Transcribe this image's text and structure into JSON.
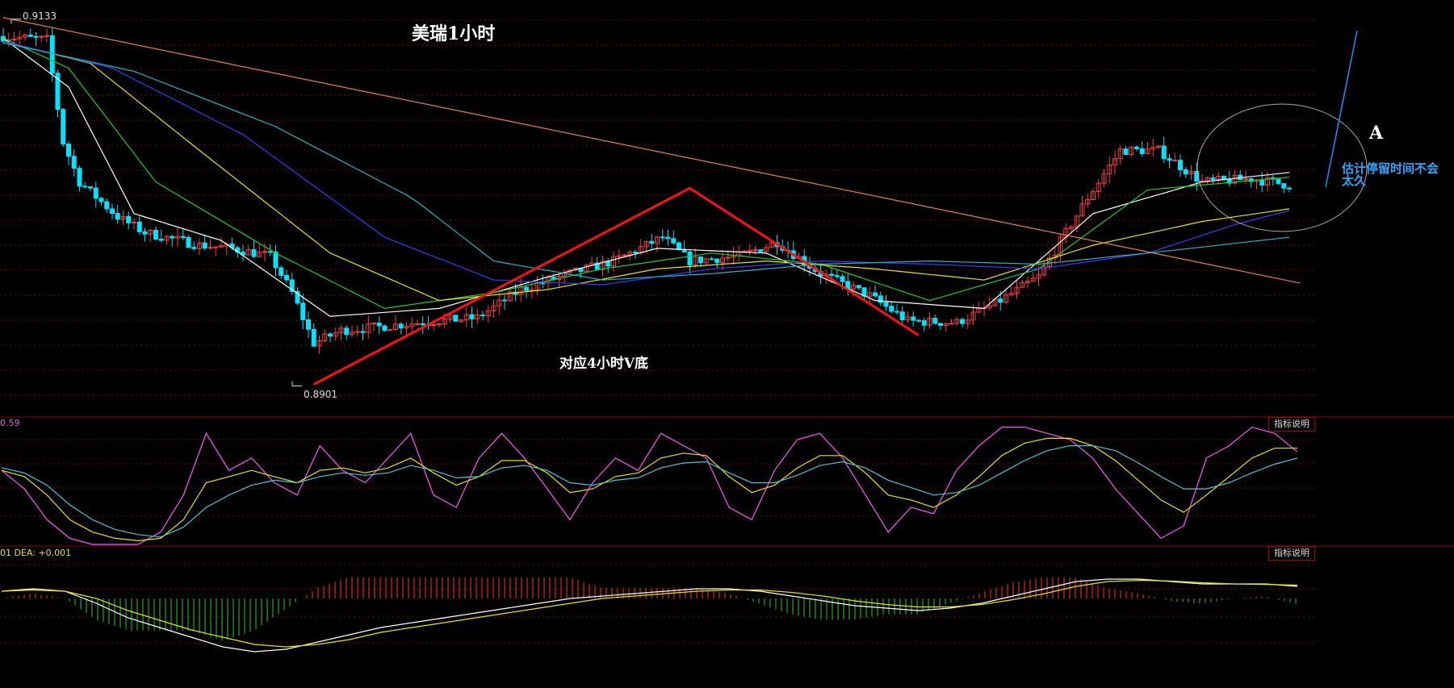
{
  "title": "美瑞1小时",
  "annotations": {
    "v_bottom": "对应4小时V底",
    "point_a": "A",
    "note": "估计停留时间不会太久"
  },
  "price_labels": {
    "high": "0.9133",
    "low": "0.8901"
  },
  "indicator_panels": [
    {
      "value_text": "0.59",
      "button": "指标说明"
    },
    {
      "value_text": "01 DEA: +0.001",
      "button": "指标说明"
    }
  ],
  "colors": {
    "background": "#000000",
    "grid": "#8b0000",
    "up_candle": "#ff3b3b",
    "down_candle": "#00e5ff",
    "trendline": "#e8804a",
    "v_pattern": "#ff1010",
    "forecast_line": "#1e90ff",
    "ma_white": "#ffffff",
    "ma_yellow": "#e6e600",
    "ma_green": "#22cc22",
    "ma_magenta": "#ff44ff",
    "ma_blue": "#3a3aff",
    "ma_cyan": "#22b8cc",
    "kdj_k": "#ff55ff",
    "kdj_d": "#e6e600",
    "kdj_j": "#44c8d8",
    "macd_dif": "#ffffff",
    "macd_dea": "#e6e600",
    "macd_pos": "#ff3030",
    "macd_neg": "#22cc22"
  },
  "chart_data": [
    {
      "type": "candlestick",
      "timeframe": "1小时",
      "price_high": 0.9133,
      "price_low": 0.8901,
      "ylim": [
        0.889,
        0.914
      ],
      "close_path": [
        [
          0,
          0.9122
        ],
        [
          8,
          0.912
        ],
        [
          11,
          0.9055
        ],
        [
          14,
          0.903
        ],
        [
          21,
          0.9008
        ],
        [
          26,
          0.8998
        ],
        [
          36,
          0.899
        ],
        [
          42,
          0.8988
        ],
        [
          49,
          0.8983
        ],
        [
          53,
          0.896
        ],
        [
          57,
          0.8928
        ],
        [
          62,
          0.8936
        ],
        [
          68,
          0.8938
        ],
        [
          79,
          0.8942
        ],
        [
          87,
          0.8944
        ],
        [
          95,
          0.8962
        ],
        [
          104,
          0.8972
        ],
        [
          112,
          0.898
        ],
        [
          121,
          0.8995
        ],
        [
          126,
          0.898
        ],
        [
          135,
          0.8983
        ],
        [
          142,
          0.8992
        ],
        [
          150,
          0.8972
        ],
        [
          159,
          0.8958
        ],
        [
          166,
          0.8942
        ],
        [
          175,
          0.8941
        ],
        [
          182,
          0.8953
        ],
        [
          190,
          0.897
        ],
        [
          199,
          0.902
        ],
        [
          205,
          0.905
        ],
        [
          212,
          0.905
        ],
        [
          220,
          0.903
        ],
        [
          229,
          0.9032
        ],
        [
          236,
          0.9028
        ]
      ],
      "moving_averages": [
        {
          "color": "ma_white",
          "points": [
            [
              0,
              0.9121
            ],
            [
              12,
              0.909
            ],
            [
              24,
              0.901
            ],
            [
              40,
              0.8993
            ],
            [
              60,
              0.8945
            ],
            [
              80,
              0.895
            ],
            [
              100,
              0.897
            ],
            [
              120,
              0.8988
            ],
            [
              140,
              0.8985
            ],
            [
              160,
              0.8955
            ],
            [
              180,
              0.895
            ],
            [
              200,
              0.901
            ],
            [
              220,
              0.903
            ],
            [
              236,
              0.9036
            ]
          ]
        },
        {
          "color": "ma_green",
          "points": [
            [
              0,
              0.9121
            ],
            [
              12,
              0.9102
            ],
            [
              28,
              0.903
            ],
            [
              50,
              0.8985
            ],
            [
              70,
              0.895
            ],
            [
              90,
              0.896
            ],
            [
              110,
              0.8975
            ],
            [
              130,
              0.8985
            ],
            [
              150,
              0.8978
            ],
            [
              170,
              0.8955
            ],
            [
              190,
              0.8975
            ],
            [
              210,
              0.9025
            ],
            [
              236,
              0.9033
            ]
          ]
        },
        {
          "color": "ma_yellow",
          "points": [
            [
              0,
              0.9119
            ],
            [
              16,
              0.9105
            ],
            [
              36,
              0.905
            ],
            [
              60,
              0.8985
            ],
            [
              80,
              0.8955
            ],
            [
              100,
              0.8962
            ],
            [
              120,
              0.8975
            ],
            [
              140,
              0.898
            ],
            [
              160,
              0.8975
            ],
            [
              180,
              0.8968
            ],
            [
              200,
              0.899
            ],
            [
              220,
              0.9005
            ],
            [
              236,
              0.9013
            ]
          ]
        },
        {
          "color": "ma_blue",
          "points": [
            [
              0,
              0.9119
            ],
            [
              20,
              0.9102
            ],
            [
              44,
              0.906
            ],
            [
              70,
              0.8995
            ],
            [
              90,
              0.8968
            ],
            [
              110,
              0.8965
            ],
            [
              130,
              0.8975
            ],
            [
              150,
              0.898
            ],
            [
              170,
              0.8978
            ],
            [
              190,
              0.8975
            ],
            [
              210,
              0.8985
            ],
            [
              226,
              0.9003
            ],
            [
              236,
              0.9012
            ]
          ]
        },
        {
          "color": "ma_cyan",
          "points": [
            [
              0,
              0.9118
            ],
            [
              24,
              0.91
            ],
            [
              50,
              0.9065
            ],
            [
              75,
              0.902
            ],
            [
              90,
              0.898
            ],
            [
              110,
              0.8968
            ],
            [
              130,
              0.8972
            ],
            [
              150,
              0.8978
            ],
            [
              170,
              0.898
            ],
            [
              190,
              0.8978
            ],
            [
              210,
              0.8985
            ],
            [
              236,
              0.8995
            ]
          ]
        }
      ],
      "trendlines": [
        {
          "color": "trendline",
          "from": [
            0,
            0.9134
          ],
          "to": [
            238,
            0.8966
          ]
        }
      ],
      "pattern": {
        "color": "v_pattern",
        "points": [
          [
            57,
            0.8902
          ],
          [
            126,
            0.9026
          ],
          [
            168,
            0.8933
          ]
        ]
      }
    },
    {
      "type": "line",
      "indicator": "KDJ",
      "series": [
        {
          "color": "kdj_k",
          "values": [
            60,
            45,
            20,
            5,
            0,
            0,
            0,
            10,
            40,
            90,
            60,
            70,
            50,
            40,
            80,
            60,
            50,
            70,
            90,
            40,
            30,
            70,
            90,
            70,
            45,
            20,
            50,
            70,
            60,
            90,
            80,
            70,
            30,
            20,
            60,
            85,
            90,
            70,
            40,
            10,
            30,
            25,
            60,
            80,
            95,
            95,
            90,
            85,
            70,
            45,
            25,
            5,
            15,
            70,
            80,
            95,
            90,
            75
          ]
        },
        {
          "color": "kdj_d",
          "values": [
            60,
            55,
            40,
            20,
            10,
            5,
            3,
            5,
            20,
            50,
            55,
            60,
            55,
            50,
            60,
            62,
            58,
            62,
            70,
            58,
            48,
            55,
            68,
            68,
            58,
            42,
            45,
            55,
            58,
            70,
            74,
            72,
            55,
            42,
            48,
            62,
            72,
            72,
            58,
            40,
            36,
            30,
            40,
            55,
            72,
            82,
            86,
            86,
            80,
            68,
            52,
            36,
            26,
            40,
            55,
            70,
            78,
            78
          ]
        },
        {
          "color": "kdj_j",
          "values": [
            62,
            58,
            48,
            32,
            20,
            12,
            8,
            6,
            14,
            30,
            40,
            48,
            52,
            50,
            55,
            58,
            56,
            58,
            64,
            60,
            54,
            55,
            62,
            64,
            60,
            50,
            48,
            52,
            54,
            62,
            66,
            67,
            58,
            50,
            50,
            56,
            64,
            67,
            62,
            52,
            46,
            40,
            42,
            48,
            58,
            68,
            76,
            80,
            80,
            76,
            66,
            55,
            45,
            45,
            50,
            58,
            65,
            70
          ]
        }
      ]
    },
    {
      "type": "line",
      "indicator": "MACD",
      "dea": 0.001,
      "series": [
        {
          "color": "macd_dif",
          "values": [
            0.3,
            0.4,
            0.3,
            -0.2,
            -0.8,
            -1.2,
            -1.6,
            -2.0,
            -2.2,
            -2.1,
            -1.8,
            -1.5,
            -1.2,
            -1.0,
            -0.8,
            -0.6,
            -0.4,
            -0.2,
            0,
            0.1,
            0.2,
            0.3,
            0.4,
            0.4,
            0.3,
            0.1,
            -0.1,
            -0.3,
            -0.4,
            -0.5,
            -0.4,
            -0.2,
            0.1,
            0.4,
            0.7,
            0.8,
            0.8,
            0.7,
            0.6,
            0.6,
            0.6,
            0.5
          ]
        },
        {
          "color": "macd_dea",
          "values": [
            0.3,
            0.35,
            0.3,
            0,
            -0.5,
            -0.9,
            -1.3,
            -1.6,
            -1.9,
            -2.0,
            -1.9,
            -1.7,
            -1.4,
            -1.2,
            -1.0,
            -0.8,
            -0.6,
            -0.4,
            -0.2,
            0,
            0.1,
            0.2,
            0.3,
            0.35,
            0.35,
            0.25,
            0.1,
            -0.1,
            -0.25,
            -0.35,
            -0.35,
            -0.25,
            -0.05,
            0.2,
            0.5,
            0.7,
            0.75,
            0.72,
            0.65,
            0.6,
            0.58,
            0.55
          ]
        }
      ]
    }
  ]
}
